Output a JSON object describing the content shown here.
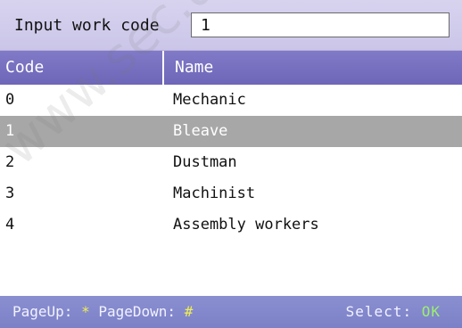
{
  "input": {
    "label": "Input work code",
    "value": "1"
  },
  "table": {
    "headers": {
      "code": "Code",
      "name": "Name"
    },
    "rows": [
      {
        "code": "0",
        "name": "Mechanic"
      },
      {
        "code": "1",
        "name": "Bleave",
        "selected": true
      },
      {
        "code": "2",
        "name": "Dustman"
      },
      {
        "code": "3",
        "name": "Machinist"
      },
      {
        "code": "4",
        "name": "Assembly workers"
      }
    ]
  },
  "footer": {
    "pageup_label": "PageUp:",
    "pageup_key": "*",
    "pagedown_label": "PageDown:",
    "pagedown_key": "#",
    "select_label": "Select:",
    "select_key": "OK"
  },
  "watermark": "www.sec.ua",
  "colors": {
    "header_bg": "#7a73c2",
    "input_bar_bg": "#d3cfee",
    "selected_row_bg": "#a7a7a7",
    "footer_bg": "#8a8fd1",
    "footer_key_color": "#f0ef55",
    "footer_ok_color": "#9cf06f"
  }
}
